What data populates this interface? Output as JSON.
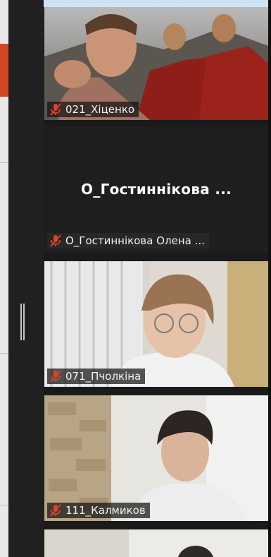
{
  "participants": [
    {
      "id": "p1",
      "label": "021_Хіценко",
      "video": true
    },
    {
      "id": "p2",
      "label": "О_Гостиннікова Олена ...",
      "center_name": "О_Гостиннікова ...",
      "video": false
    },
    {
      "id": "p3",
      "label": "071_Пчолкіна",
      "video": true
    },
    {
      "id": "p4",
      "label": "111_Калмиков",
      "video": true
    },
    {
      "id": "p5",
      "label": "",
      "video": true
    }
  ],
  "icons": {
    "muted_mic": "muted-microphone-icon",
    "splitter": "splitter-handle-icon"
  },
  "colors": {
    "muted": "#e0412a",
    "tile_bg": "#232323",
    "accent": "#d24726"
  }
}
